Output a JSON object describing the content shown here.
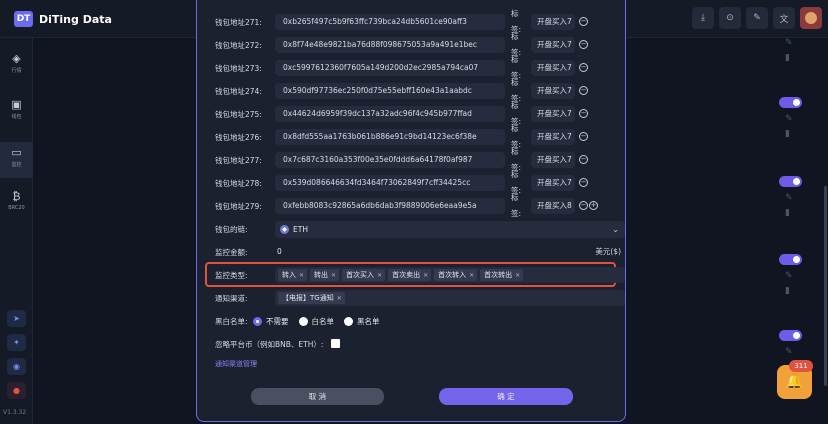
{
  "app": {
    "logo_mark": "DT",
    "title": "DiTing Data",
    "version": "V1.3.32"
  },
  "topbar_icons": [
    "download-icon",
    "wallet-icon",
    "edit-icon",
    "translate-icon"
  ],
  "sidebar": {
    "items": [
      {
        "icon": "layers-icon",
        "label": "行情"
      },
      {
        "icon": "wallet-icon",
        "label": "钱包"
      },
      {
        "icon": "monitor-icon",
        "label": "监控"
      },
      {
        "icon": "bitcoin-icon",
        "label": "BRC20"
      }
    ],
    "social": [
      "telegram-icon",
      "twitter-icon",
      "discord-icon",
      "weibo-icon"
    ]
  },
  "modal": {
    "addresses": [
      {
        "label": "钱包地址271:",
        "value": "0xb265f497c5b9f63ffc739bca24db5601ce90aff3",
        "tag_label": "标签:",
        "tag": "开盘买入7"
      },
      {
        "label": "钱包地址272:",
        "value": "0x8f74e48e9821ba76d88f098675053a9a491e1bec",
        "tag_label": "标签:",
        "tag": "开盘买入7"
      },
      {
        "label": "钱包地址273:",
        "value": "0xc5997612360f7605a149d200d2ec2985a794ca07",
        "tag_label": "标签:",
        "tag": "开盘买入7"
      },
      {
        "label": "钱包地址274:",
        "value": "0x590df97736ec250f0d75e55ebff160e43a1aabdc",
        "tag_label": "标签:",
        "tag": "开盘买入7"
      },
      {
        "label": "钱包地址275:",
        "value": "0x44624d6959f39dc137a32adc96f4c945b977ffad",
        "tag_label": "标签:",
        "tag": "开盘买入7"
      },
      {
        "label": "钱包地址276:",
        "value": "0x8dfd555aa1763b061b886e91c9bd14123ec6f38e",
        "tag_label": "标签:",
        "tag": "开盘买入7"
      },
      {
        "label": "钱包地址277:",
        "value": "0x7c687c3160a353f00e35e0fddd6a64178f0af987",
        "tag_label": "标签:",
        "tag": "开盘买入7"
      },
      {
        "label": "钱包地址278:",
        "value": "0x539d086646634fd3464f73062849f7cff34425cc",
        "tag_label": "标签:",
        "tag": "开盘买入7"
      },
      {
        "label": "钱包地址279:",
        "value": "0xfebb8083c92865a6db6dab3f9889006e6eaa9e5a",
        "tag_label": "标签:",
        "tag": "开盘买入8"
      }
    ],
    "chain": {
      "label": "钱包的链:",
      "value": "ETH"
    },
    "amount": {
      "label": "监控金额:",
      "value": "0",
      "unit": "美元($)"
    },
    "monitor_type": {
      "label": "监控类型:",
      "chips": [
        "转入",
        "转出",
        "首次买入",
        "首次卖出",
        "首次转入",
        "首次转出"
      ]
    },
    "notify_channel": {
      "label": "通知渠道:",
      "chips": [
        "【电报】TG通知"
      ]
    },
    "blackwhite": {
      "label": "黑白名单:",
      "options": [
        "不需要",
        "白名单",
        "黑名单"
      ],
      "selected": "不需要"
    },
    "ignore_platform": {
      "label": "忽略平台币（例如BNB、ETH）:",
      "checked": false
    },
    "manage_link": "通知渠道管理",
    "cancel": "取 消",
    "confirm": "确 定"
  },
  "notification": {
    "count": "311"
  },
  "colors": {
    "accent": "#7464ea",
    "highlight": "#e2533f",
    "notify": "#f0a13a"
  }
}
